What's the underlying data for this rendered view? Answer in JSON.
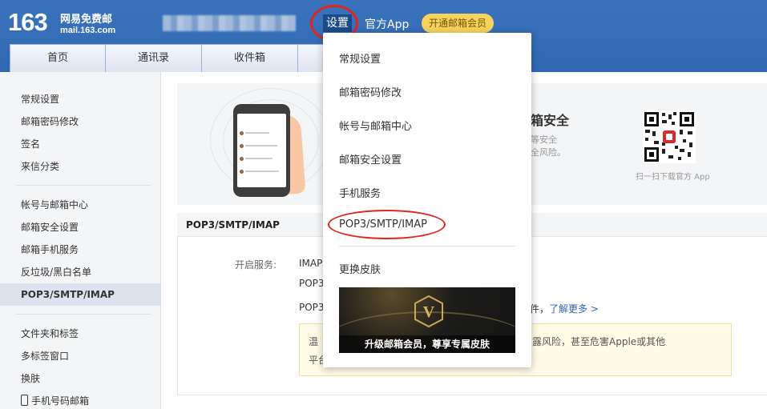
{
  "header": {
    "logo_number": "163",
    "logo_cn": "网易免费邮",
    "logo_domain": "mail.163.com",
    "settings_label": "设置",
    "app_label": "官方App",
    "vip_label": "开通邮箱会员"
  },
  "nav": {
    "tabs": [
      "首页",
      "通讯录",
      "收件箱",
      ""
    ]
  },
  "sidebar": {
    "group1": [
      "常规设置",
      "邮箱密码修改",
      "签名",
      "来信分类"
    ],
    "group2": [
      "帐号与邮箱中心",
      "邮箱安全设置",
      "邮箱手机服务",
      "反垃圾/黑白名单",
      "POP3/SMTP/IMAP"
    ],
    "group3": [
      "文件夹和标签",
      "多标签窗口",
      "换肤",
      "手机号码邮箱"
    ],
    "active": "POP3/SMTP/IMAP"
  },
  "banner": {
    "title": "保邮箱安全",
    "line1": "等安全",
    "line2": "全风险。",
    "qr_caption": "扫一扫下载官方 App"
  },
  "section": {
    "title": "POP3/SMTP/IMAP",
    "service_label": "开启服务:",
    "service_1": "IMAP",
    "service_2": "POP3",
    "service_3": "POP3",
    "more_prefix": "件，",
    "more_link": "了解更多 >",
    "tip_left_1": "温",
    "tip_left_2": "平台",
    "tip_right": "露风险，甚至危害Apple或其他"
  },
  "menu": {
    "items": [
      "常规设置",
      "邮箱密码修改",
      "帐号与邮箱中心",
      "邮箱安全设置",
      "手机服务",
      "POP3/SMTP/IMAP",
      "更换皮肤"
    ],
    "skin_caption": "升级邮箱会员，尊享专属皮肤"
  },
  "colors": {
    "header_blue": "#3167b1",
    "highlight_red": "#e0261b",
    "vip_yellow": "#f5d35d",
    "link_blue": "#2d64b3"
  }
}
